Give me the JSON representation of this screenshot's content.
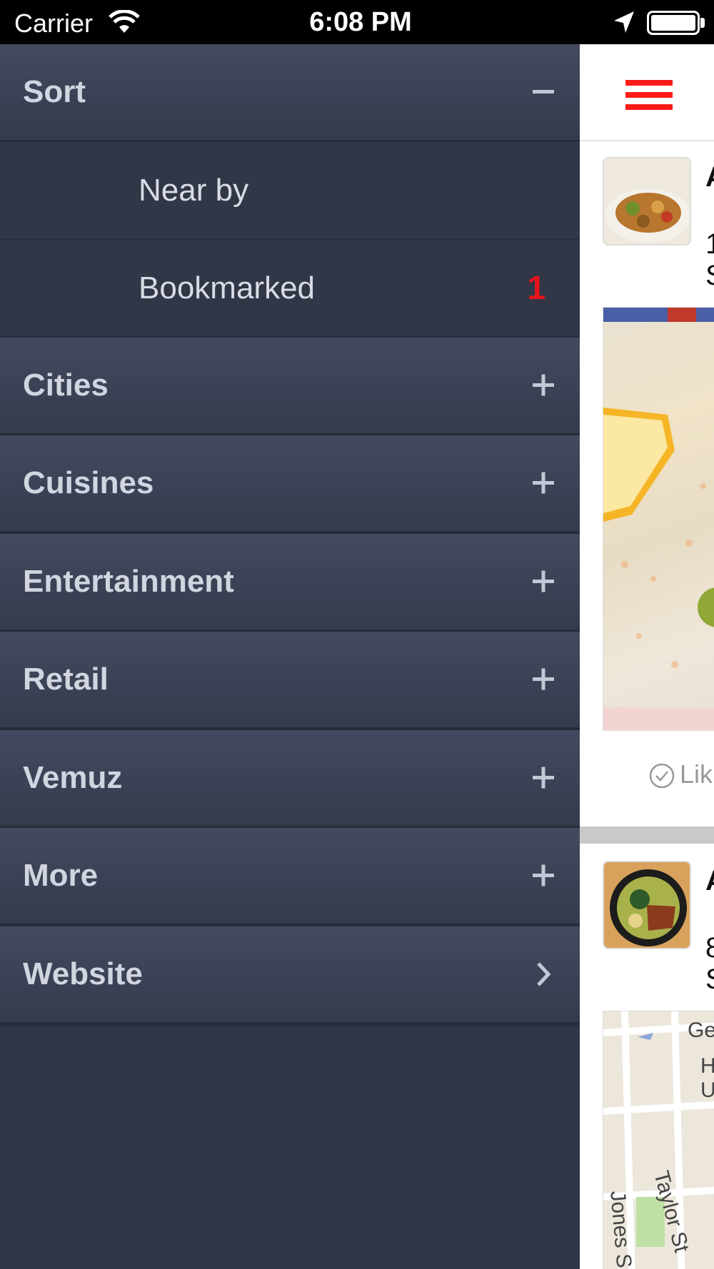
{
  "status_bar": {
    "carrier": "Carrier",
    "time": "6:08 PM",
    "wifi_icon": "wifi-icon",
    "location_icon": "location-arrow-icon",
    "battery_icon": "battery-icon"
  },
  "menu": {
    "sections": [
      {
        "label": "Sort",
        "state": "expanded",
        "indicator": "−"
      },
      {
        "label": "Cities",
        "state": "collapsed",
        "indicator": "+"
      },
      {
        "label": "Cuisines",
        "state": "collapsed",
        "indicator": "+"
      },
      {
        "label": "Entertainment",
        "state": "collapsed",
        "indicator": "+"
      },
      {
        "label": "Retail",
        "state": "collapsed",
        "indicator": "+"
      },
      {
        "label": "Vemuz",
        "state": "collapsed",
        "indicator": "+"
      },
      {
        "label": "More",
        "state": "collapsed",
        "indicator": "+"
      },
      {
        "label": "Website",
        "state": "link",
        "indicator": "›"
      }
    ],
    "sort_items": [
      {
        "label": "Near by",
        "count": ""
      },
      {
        "label": "Bookmarked",
        "count": "1"
      }
    ],
    "badge_color": "#e8141b"
  },
  "content": {
    "menu_button_icon": "hamburger-menu-icon",
    "accent_color": "#ff1a1a",
    "posts": [
      {
        "title": "A",
        "line1": "1",
        "line2": "S"
      },
      {
        "title": "A",
        "line1": "8",
        "line2": "S"
      }
    ],
    "like_label": "Lik",
    "map_streets": [
      "Ge",
      "H",
      "U",
      "Taylor St",
      "Jones S"
    ]
  }
}
